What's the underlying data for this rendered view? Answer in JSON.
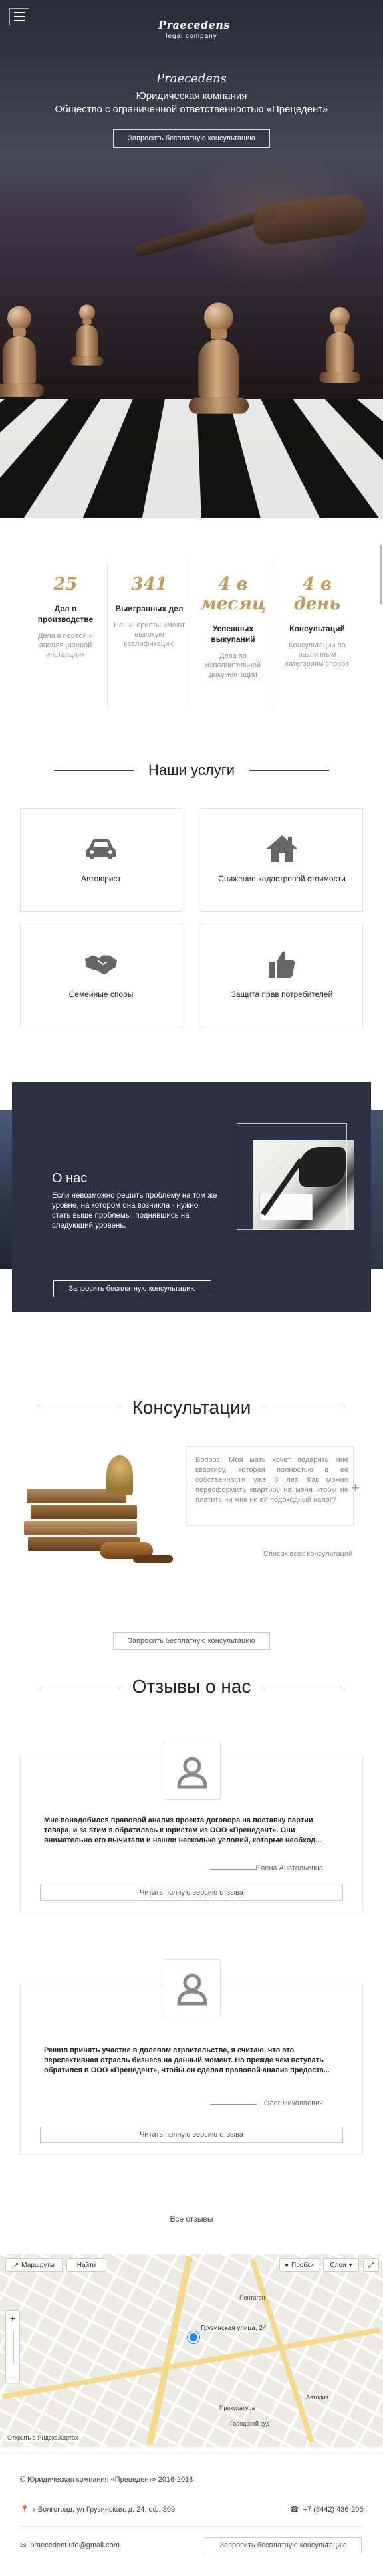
{
  "hero": {
    "logo_script": "Prаecedens",
    "logo_sub": "legal company",
    "script_title": "Prаecedens",
    "line1": "Юридическая компания",
    "line2": "Общество с ограниченной ответственностью «Прецедент»",
    "cta": "Запросить бесплатную консультацию"
  },
  "stats": [
    {
      "num": "25",
      "title": "Дел в производстве",
      "desc": "Дела в первой и апелляционной инстанциях"
    },
    {
      "num": "341",
      "title": "Выигранных дел",
      "desc": "Наши юристы имеют высокую квалификацию"
    },
    {
      "num": "4 в месяц",
      "title": "Успешных выкупаний",
      "desc": "Дела по исполнительной документации"
    },
    {
      "num": "4 в день",
      "title": "Консультаций",
      "desc": "Консультации по различным категориям споров"
    }
  ],
  "services": {
    "heading": "Наши услуги",
    "items": [
      {
        "label": "Автоюрист",
        "icon": "car-icon"
      },
      {
        "label": "Снижение кадастровой стоимости",
        "icon": "house-icon"
      },
      {
        "label": "Семейные споры",
        "icon": "handshake-icon"
      },
      {
        "label": "Защита прав потребителей",
        "icon": "thumbs-up-icon"
      }
    ]
  },
  "about": {
    "title": "О нас",
    "text": "Если невозможно решить проблему на том же уровне, на котором она возникла - нужно стать выше проблемы, поднявшись на следующий уровень.",
    "cta": "Запросить бесплатную консультацию"
  },
  "consult": {
    "heading": "Консультации",
    "question": "Вопрос: Моя мать хочет подарить мне квартиру, которая полностью в её собственности уже 6 лет. Как можно переоформить квартиру на меня чтобы не платить ни мне ни ей подоходный налог?",
    "all_link": "Список всех консультаций",
    "cta": "Запросить бесплатную консультацию"
  },
  "reviews": {
    "heading": "Отзывы о нас",
    "items": [
      {
        "text": "Мне понадобился правовой анализ проекта договора на поставку партии товара, и за этим я обратилась к юристам из ООО «Прецедент». Они внимательно его вычитали и нашли несколько условий, которые необход...",
        "author": "Елена Анатольевна",
        "button": "Читать полную версию отзыва"
      },
      {
        "text": "Решил принять участие в долевом строительстве, я считаю, что это перспективная отрасль бизнеса на данный момент. Но прежде чем вступать обратился в ООО «Прецедент», чтобы он сделал правовой анализ предоста...",
        "author": "Олег Николаевич",
        "button": "Читать полную версию отзыва"
      }
    ],
    "all_link": "Все отзывы"
  },
  "map": {
    "controls": [
      "Маршруты",
      "Найти",
      "Пробки",
      "Слои"
    ],
    "pin_label": "Грузинская улица, 24",
    "poi": [
      "Пентагон",
      "Автодиз",
      "Прокуратура",
      "Городской суд"
    ],
    "open_link": "Открыть в Яндекс.Картах"
  },
  "footer": {
    "copyright": "© Юридическая компания «Прецедент» 2016-2018",
    "address": "г Волгоград, ул Грузинская, д. 24, оф. 309",
    "phone": "+7 (8442) 436-205",
    "email": "praecedent.ufo@gmail.com",
    "cta": "Запросить бесплатную консультацию"
  }
}
